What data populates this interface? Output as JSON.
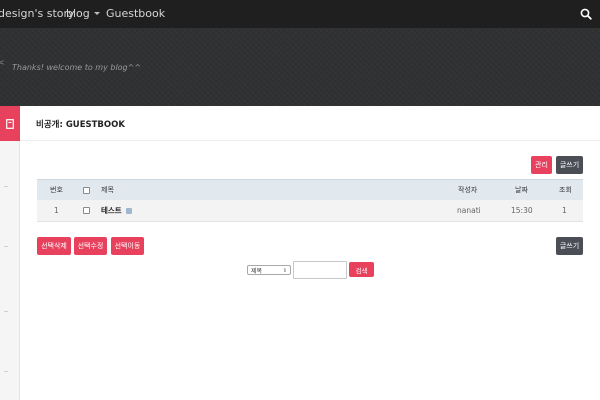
{
  "nav": {
    "brand": "design's story",
    "blog": "blog",
    "guestbook": "Guestbook",
    "search_icon": "search-icon"
  },
  "hero": {
    "welcome": "Thanks! welcome to my blog^^",
    "mark": "<"
  },
  "page": {
    "title": "비공개: GUESTBOOK"
  },
  "actions": {
    "manage": "관리",
    "write": "글쓰기",
    "delete_selected": "선택삭제",
    "edit_selected": "선택수정",
    "move_selected": "선택이동"
  },
  "table": {
    "headers": {
      "no": "번호",
      "title": "제목",
      "author": "작성자",
      "date": "날짜",
      "views": "조회"
    },
    "rows": [
      {
        "no": "1",
        "title": "테스트",
        "author": "nanati",
        "date": "15:30",
        "views": "1",
        "locked": true
      }
    ]
  },
  "search": {
    "field_selected": "제목",
    "query": "",
    "button": "검색"
  },
  "colors": {
    "accent": "#e8415e",
    "dark_button": "#4b4e54",
    "topnav": "#1f1f20",
    "hero": "#303133",
    "table_header": "#e1e9ef"
  }
}
